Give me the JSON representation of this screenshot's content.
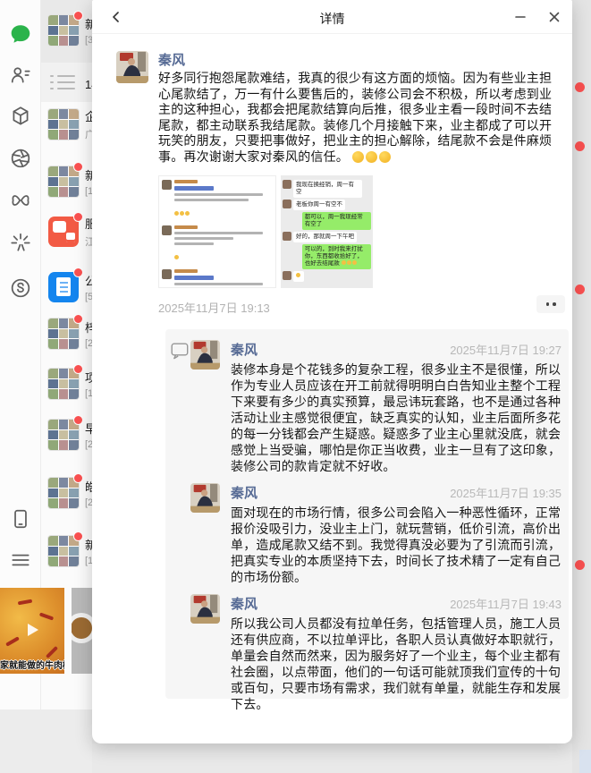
{
  "window": {
    "title": "详情"
  },
  "post": {
    "author": "秦风",
    "text": "好多同行抱怨尾款难结，我真的很少有这方面的烦恼。因为有些业主担心尾款结了，万一有什么要售后的，装修公司会不积极，所以考虑到业主的这种担心，我都会把尾款结算向后推，很多业主看一段时间不去结尾款，都主动联系我结尾款。装修几个月接触下来，业主都成了可以开玩笑的朋友，只要把事做好，把业主的担心解除，结尾款不会是件麻烦事。再次谢谢大家对秦风的信任。",
    "time": "2025年11月7日 19:13"
  },
  "comments": [
    {
      "author": "秦风",
      "time": "2025年11月7日 19:27",
      "text": "装修本身是个花钱多的复杂工程，很多业主不是很懂，所以作为专业人员应该在开工前就得明明白白告知业主整个工程下来要有多少的真实预算，最忌讳玩套路，也不是通过各种活动让业主感觉很便宜，缺乏真实的认知，业主后面所多花的每一分钱都会产生疑惑。疑惑多了业主心里就没底，就会感觉上当受骗，哪怕是你正当收费，业主一旦有了这印象，装修公司的款肯定就不好收。"
    },
    {
      "author": "秦风",
      "time": "2025年11月7日 19:35",
      "text": "面对现在的市场行情，很多公司会陷入一种恶性循环，正常报价没吸引力，没业主上门，就玩营销，低价引流，高价出单，造成尾款又结不到。我觉得真没必要为了引流而引流，把真实专业的本质坚持下去，时间长了技术精了一定有自己的市场份额。"
    },
    {
      "author": "秦风",
      "time": "2025年11月7日 19:43",
      "text": "所以我公司人员都没有拉单任务，包括管理人员，施工人员还有供应商，不以拉单评比，各职人员认真做好本职就行，单量会自然而然来，因为服务好了一个业主，每个业主都有社会圈，以点带面，他们的一句话可能就顶我们宣传的十句或百句，只要市场有需求，我们就有单量，就能生存和发展下去。"
    }
  ],
  "chat_list": {
    "items": [
      {
        "title": "新",
        "subtitle": "[3"
      },
      {
        "title": "14",
        "subtitle": ""
      },
      {
        "title": "企",
        "subtitle": "广"
      },
      {
        "title": "新",
        "subtitle": "[1"
      },
      {
        "title": "服",
        "subtitle": "江"
      },
      {
        "title": "公",
        "subtitle": "[5"
      },
      {
        "title": "梓",
        "subtitle": "[2"
      },
      {
        "title": "项",
        "subtitle": "[1"
      },
      {
        "title": "早",
        "subtitle": "[2"
      },
      {
        "title": "皓",
        "subtitle": "[2"
      },
      {
        "title": "新",
        "subtitle": "[1"
      }
    ]
  },
  "screenshot_chat": {
    "messages": [
      {
        "side": "left",
        "text": "我现在换经销，周一有空"
      },
      {
        "side": "left",
        "text": "老板你周一有空不"
      },
      {
        "side": "right",
        "text": "都可以，周一我现经常有空了"
      },
      {
        "side": "left",
        "text": "好的，那就周一下午吧"
      },
      {
        "side": "right",
        "text": "可以的，到时我来打扰你，东西都收拾好了，也好去结尾款"
      }
    ]
  },
  "video_feed": {
    "caption": "家就能做的牛肉椒麻"
  },
  "colors": {
    "accent_green": "#2bb34b",
    "badge_red": "#fa5151",
    "name_blue": "#576b95",
    "bubble_green": "#95ec69"
  }
}
